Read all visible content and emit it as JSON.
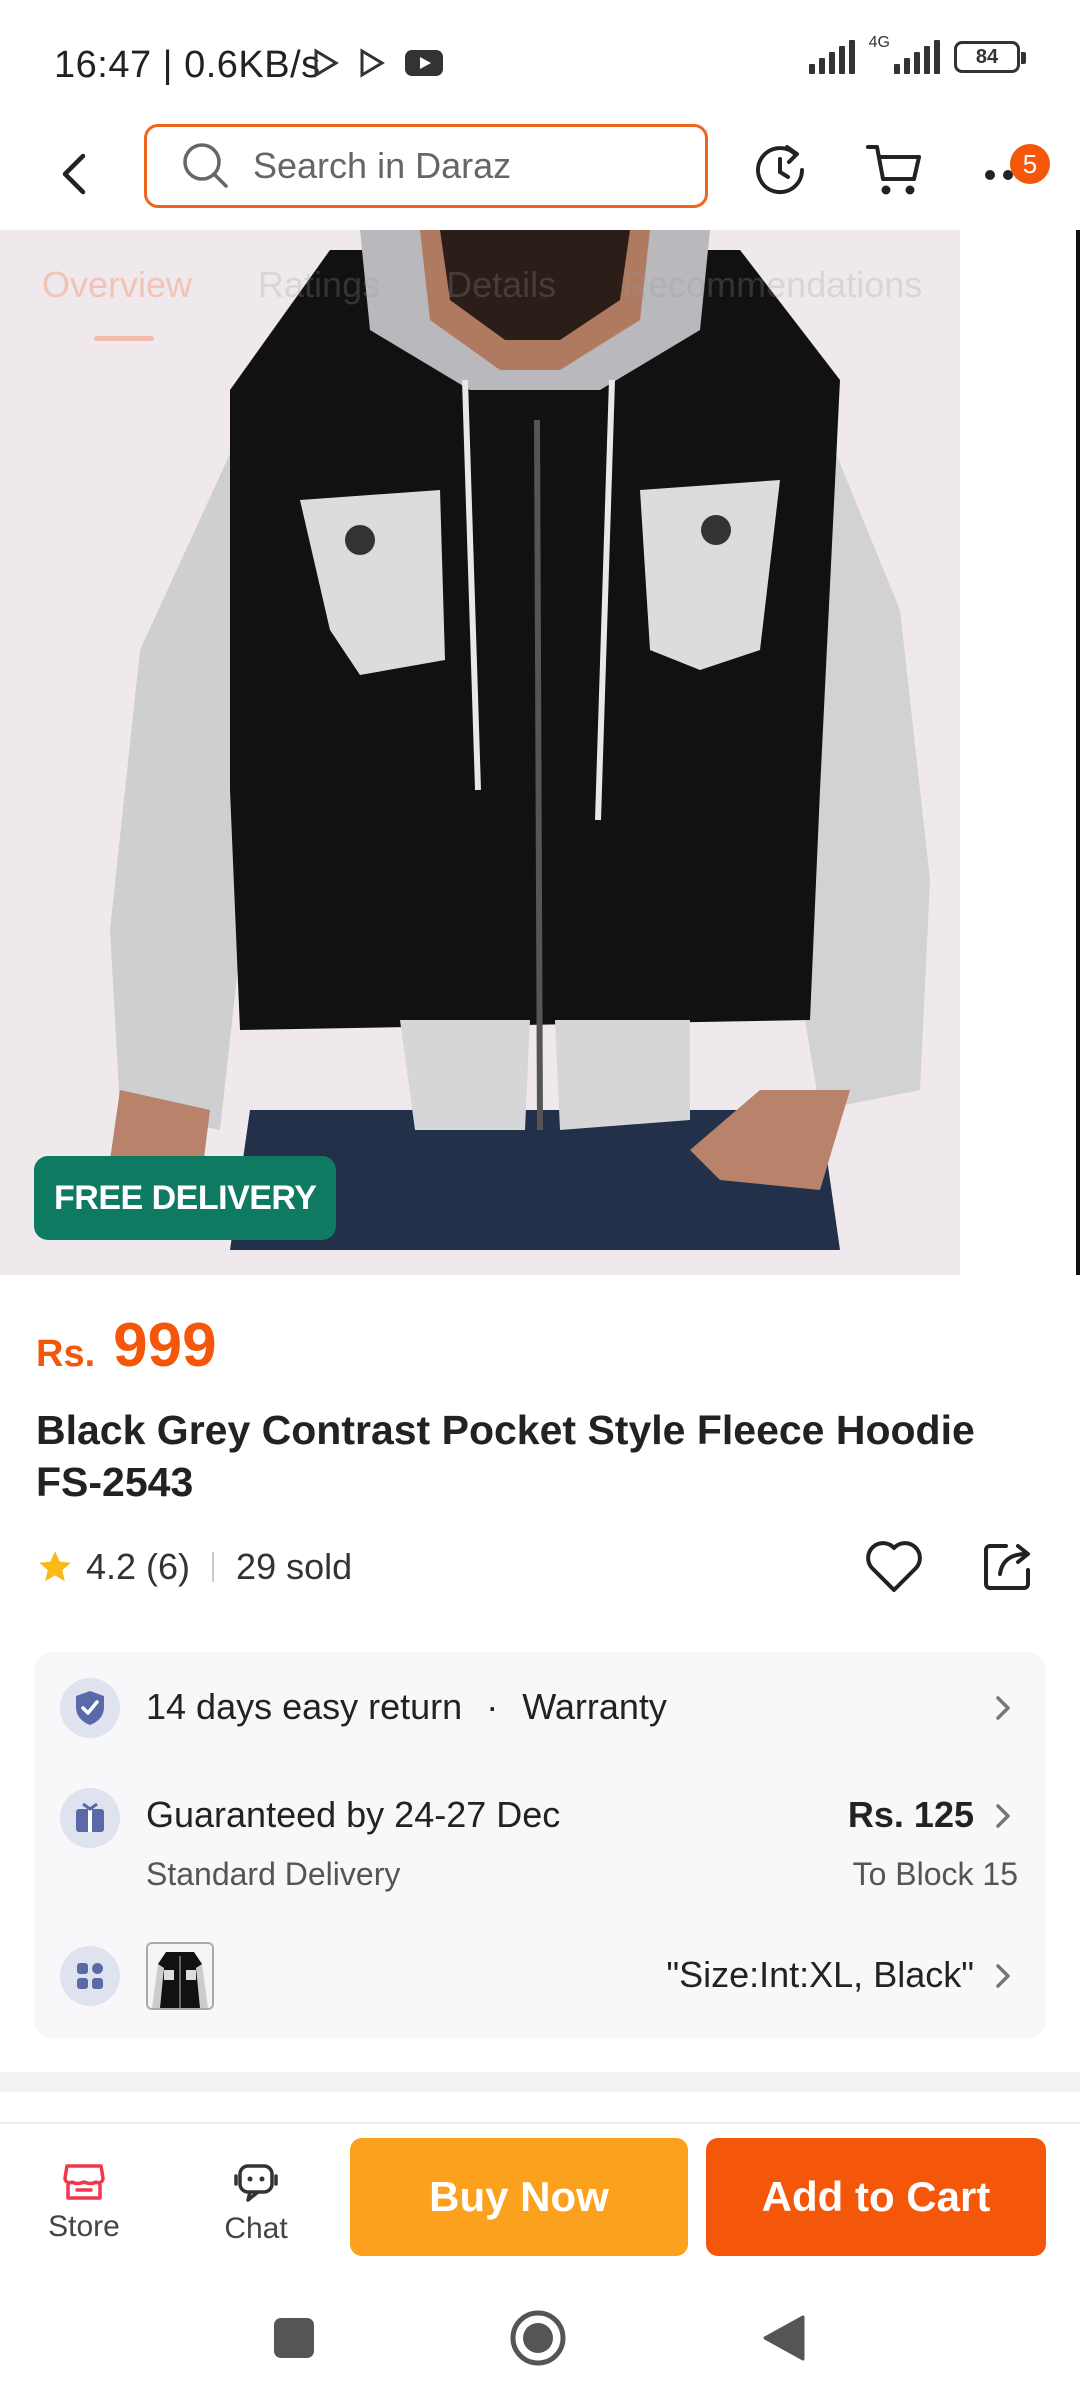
{
  "status_bar": {
    "time": "16:47 | 0.6KB/s",
    "network": "4G",
    "battery": "84"
  },
  "header": {
    "search_placeholder": "Search in Daraz",
    "more_badge": "5"
  },
  "gallery": {
    "tabs": [
      "Overview",
      "Ratings",
      "Details",
      "Recommendations"
    ],
    "active_tab": "Overview",
    "badge": "FREE DELIVERY"
  },
  "product": {
    "currency": "Rs.",
    "price": "999",
    "title": "Black Grey Contrast Pocket Style Fleece Hoodie FS-2543",
    "rating": "4.2",
    "rating_count": "(6)",
    "sold": "29 sold"
  },
  "services": {
    "return_text": "14 days easy return",
    "dot": "·",
    "warranty_text": "Warranty",
    "delivery_title": "Guaranteed by 24-27 Dec",
    "delivery_type": "Standard Delivery",
    "delivery_fee": "Rs. 125",
    "delivery_to": "To Block 15",
    "variant": "\"Size:Int:XL, Black\""
  },
  "actions": {
    "store_label": "Store",
    "chat_label": "Chat",
    "buy_now": "Buy Now",
    "add_to_cart": "Add to Cart"
  },
  "colors": {
    "brand_orange": "#f5570a",
    "buy_yellow": "#fca11d",
    "delivery_green": "#0e7a62"
  }
}
